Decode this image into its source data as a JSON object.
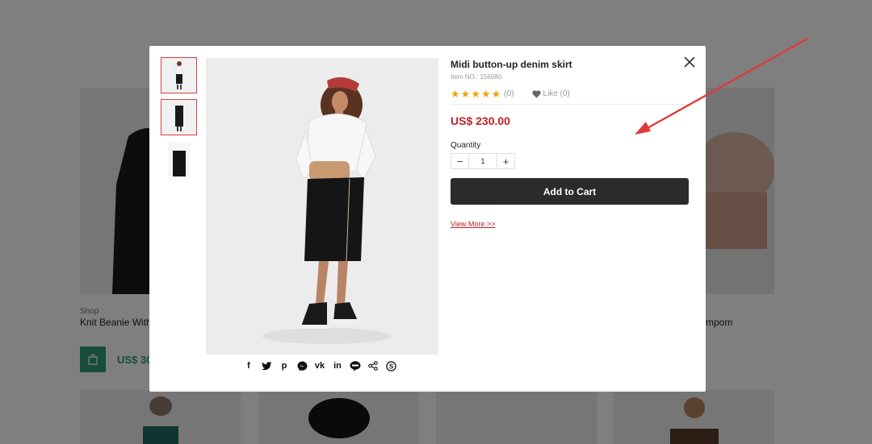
{
  "background": {
    "shop_label": "Shop",
    "product_left_name": "Knit Beanie With",
    "product_right_name": "mpom",
    "price_left": "US$ 30"
  },
  "modal": {
    "title": "Midi button-up denim skirt",
    "item_no": "Item NO.: 156080",
    "rating": {
      "stars": 5,
      "count_text": "(0)"
    },
    "like": {
      "label": "Like (0)"
    },
    "price": "US$ 230.00",
    "quantity": {
      "label": "Quantity",
      "value": "1",
      "minus": "−",
      "plus": "+"
    },
    "add_to_cart": "Add to Cart",
    "view_more": "View More >>",
    "share_icons": [
      "facebook-icon",
      "twitter-icon",
      "pinterest-icon",
      "messenger-icon",
      "vk-icon",
      "linkedin-icon",
      "line-icon",
      "share-icon",
      "skype-icon"
    ],
    "share_glyphs": [
      "f",
      "",
      "p",
      "",
      "vk",
      "in",
      "",
      "",
      "S"
    ]
  },
  "colors": {
    "accent_red": "#c0202a",
    "star": "#f2a20c",
    "cart_button": "#2b2b2b",
    "bg_green": "#2f9c75",
    "annotation_arrow": "#e03a3a"
  }
}
